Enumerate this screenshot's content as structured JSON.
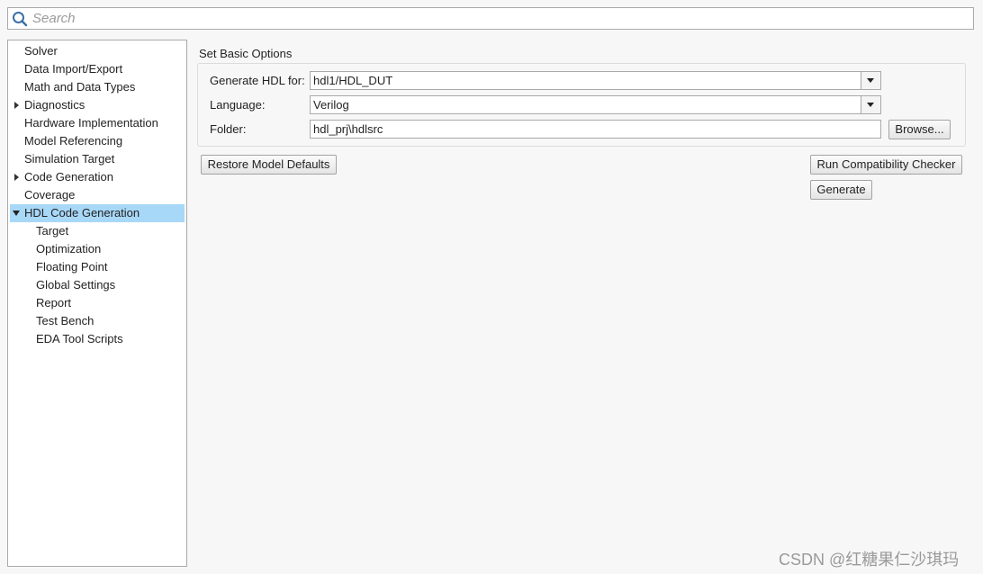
{
  "search": {
    "placeholder": "Search"
  },
  "tree": {
    "items": [
      {
        "label": "Solver"
      },
      {
        "label": "Data Import/Export"
      },
      {
        "label": "Math and Data Types"
      },
      {
        "label": "Diagnostics",
        "expander": "collapsed"
      },
      {
        "label": "Hardware Implementation"
      },
      {
        "label": "Model Referencing"
      },
      {
        "label": "Simulation Target"
      },
      {
        "label": "Code Generation",
        "expander": "collapsed"
      },
      {
        "label": "Coverage"
      },
      {
        "label": "HDL Code Generation",
        "expander": "expanded",
        "selected": true
      },
      {
        "label": "Target",
        "child": true
      },
      {
        "label": "Optimization",
        "child": true
      },
      {
        "label": "Floating Point",
        "child": true
      },
      {
        "label": "Global Settings",
        "child": true
      },
      {
        "label": "Report",
        "child": true
      },
      {
        "label": "Test Bench",
        "child": true
      },
      {
        "label": "EDA Tool Scripts",
        "child": true
      }
    ]
  },
  "main": {
    "section_title": "Set Basic Options",
    "generate_hdl_for": {
      "label": "Generate HDL for:",
      "value": "hdl1/HDL_DUT"
    },
    "language": {
      "label": "Language:",
      "value": "Verilog"
    },
    "folder": {
      "label": "Folder:",
      "value": "hdl_prj\\hdlsrc"
    },
    "browse_label": "Browse...",
    "restore_label": "Restore Model Defaults",
    "run_checker_label": "Run Compatibility Checker",
    "generate_label": "Generate"
  },
  "watermark": "CSDN @红糖果仁沙琪玛",
  "colors": {
    "selection": "#a8d8f8",
    "border": "#a9a9a9",
    "background": "#f7f7f7"
  }
}
